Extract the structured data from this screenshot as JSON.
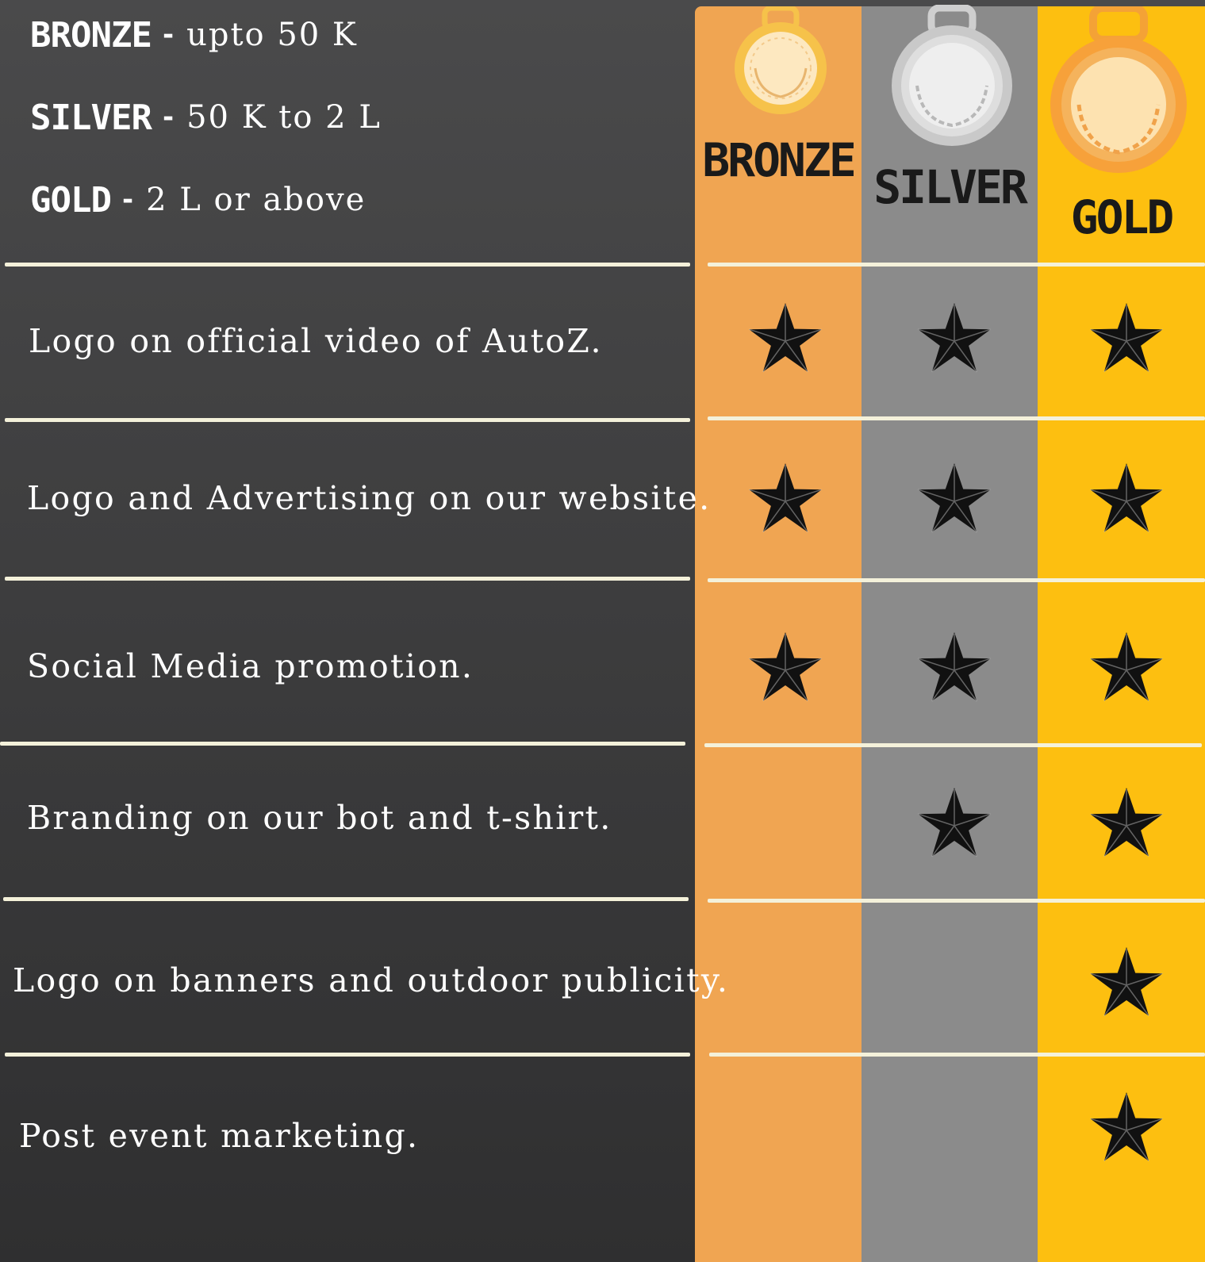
{
  "tiers": [
    {
      "name": "BRONZE",
      "separator": "-",
      "range": "upto 50 K"
    },
    {
      "name": "SILVER",
      "separator": "-",
      "range": "50 K to 2 L"
    },
    {
      "name": "GOLD",
      "separator": "-",
      "range": "2 L or above"
    }
  ],
  "columns": [
    {
      "title": "BRONZE",
      "color": "#f0a552",
      "medal_icon": "bronze-medal-icon"
    },
    {
      "title": "SILVER",
      "color": "#8b8b8b",
      "medal_icon": "silver-medal-icon"
    },
    {
      "title": "GOLD",
      "color": "#fdbf10",
      "medal_icon": "gold-medal-icon"
    }
  ],
  "features": [
    {
      "label": "Logo on official video of AutoZ.",
      "bronze": true,
      "silver": true,
      "gold": true
    },
    {
      "label": "Logo and Advertising on our website.",
      "bronze": true,
      "silver": true,
      "gold": true
    },
    {
      "label": "Social Media promotion.",
      "bronze": true,
      "silver": true,
      "gold": true
    },
    {
      "label": "Branding on our bot and t-shirt.",
      "bronze": false,
      "silver": true,
      "gold": true
    },
    {
      "label": "Logo on banners and outdoor publicity.",
      "bronze": false,
      "silver": false,
      "gold": true
    },
    {
      "label": "Post event marketing.",
      "bronze": false,
      "silver": false,
      "gold": true
    }
  ],
  "star_icon": "star-icon",
  "colors": {
    "divider": "#f4f1da",
    "star": "#111111"
  }
}
